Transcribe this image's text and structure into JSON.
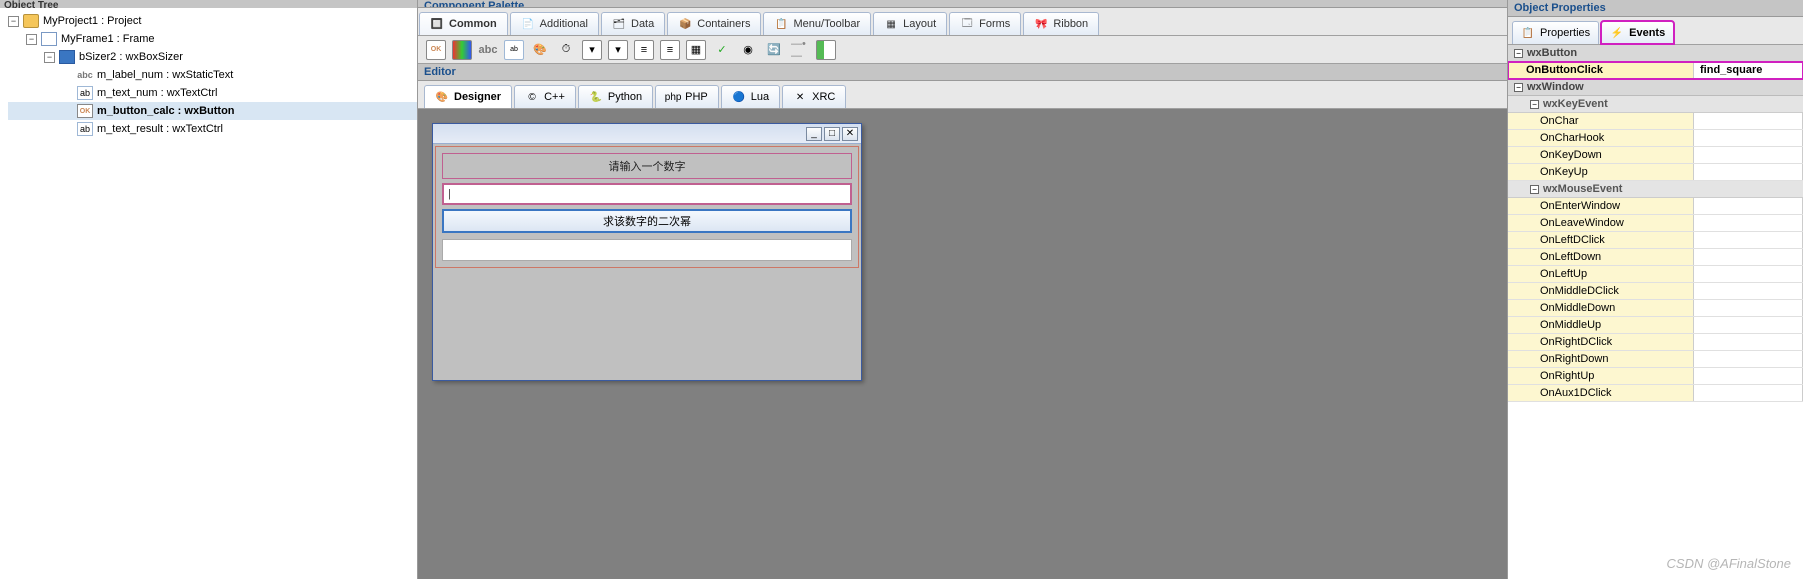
{
  "tree_header": "Object Tree",
  "tree": [
    {
      "indent": 0,
      "exp": "-",
      "icon": "project",
      "label": "MyProject1 : Project",
      "sel": false,
      "bold": false
    },
    {
      "indent": 1,
      "exp": "-",
      "icon": "frame",
      "label": "MyFrame1 : Frame",
      "sel": false,
      "bold": false
    },
    {
      "indent": 2,
      "exp": "-",
      "icon": "sizer",
      "label": "bSizer2 : wxBoxSizer",
      "sel": false,
      "bold": false
    },
    {
      "indent": 3,
      "exp": "",
      "icon": "abc",
      "label": "m_label_num : wxStaticText",
      "sel": false,
      "bold": false
    },
    {
      "indent": 3,
      "exp": "",
      "icon": "ctrl",
      "label": "m_text_num : wxTextCtrl",
      "sel": false,
      "bold": false
    },
    {
      "indent": 3,
      "exp": "",
      "icon": "btn",
      "label": "m_button_calc : wxButton",
      "sel": true,
      "bold": true
    },
    {
      "indent": 3,
      "exp": "",
      "icon": "ctrl",
      "label": "m_text_result : wxTextCtrl",
      "sel": false,
      "bold": false
    }
  ],
  "palette_title": "Component Palette",
  "palette_tabs": [
    {
      "label": "Common",
      "active": true,
      "icon": "🔲"
    },
    {
      "label": "Additional",
      "active": false,
      "icon": "📄"
    },
    {
      "label": "Data",
      "active": false,
      "icon": "🗂"
    },
    {
      "label": "Containers",
      "active": false,
      "icon": "📦"
    },
    {
      "label": "Menu/Toolbar",
      "active": false,
      "icon": "📋"
    },
    {
      "label": "Layout",
      "active": false,
      "icon": "▦"
    },
    {
      "label": "Forms",
      "active": false,
      "icon": "🗔"
    },
    {
      "label": "Ribbon",
      "active": false,
      "icon": "🎀"
    }
  ],
  "editor_title": "Editor",
  "editor_tabs": [
    {
      "label": "Designer",
      "active": true,
      "icon": "🎨"
    },
    {
      "label": "C++",
      "active": false,
      "icon": "©"
    },
    {
      "label": "Python",
      "active": false,
      "icon": "🐍"
    },
    {
      "label": "PHP",
      "active": false,
      "icon": "php"
    },
    {
      "label": "Lua",
      "active": false,
      "icon": "🔵"
    },
    {
      "label": "XRC",
      "active": false,
      "icon": "✕"
    }
  ],
  "designer": {
    "label_text": "请输入一个数字",
    "text_cursor": "|",
    "button_text": "求该数字的二次幂"
  },
  "props_title": "Object Properties",
  "props_tabs": [
    {
      "label": "Properties",
      "active": false,
      "icon": "📋",
      "hl": false
    },
    {
      "label": "Events",
      "active": true,
      "icon": "⚡",
      "hl": true
    }
  ],
  "props": {
    "cat1": "wxButton",
    "row1_name": "OnButtonClick",
    "row1_val": "find_square",
    "cat2": "wxWindow",
    "sub_key": "wxKeyEvent",
    "key_events": [
      "OnChar",
      "OnCharHook",
      "OnKeyDown",
      "OnKeyUp"
    ],
    "sub_mouse": "wxMouseEvent",
    "mouse_events": [
      "OnEnterWindow",
      "OnLeaveWindow",
      "OnLeftDClick",
      "OnLeftDown",
      "OnLeftUp",
      "OnMiddleDClick",
      "OnMiddleDown",
      "OnMiddleUp",
      "OnRightDClick",
      "OnRightDown",
      "OnRightUp",
      "OnAux1DClick"
    ]
  },
  "watermark": "CSDN @AFinalStone"
}
